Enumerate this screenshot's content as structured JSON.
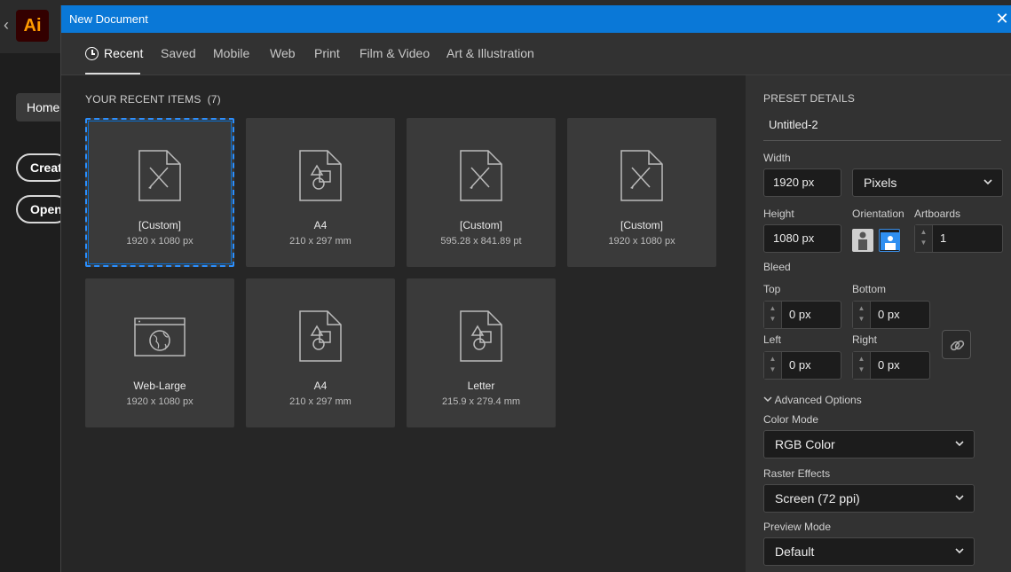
{
  "app": {
    "logo_text": "Ai",
    "home_label": "Home",
    "create_label": "Create",
    "open_label": "Open",
    "back_chevron": "‹"
  },
  "dialog": {
    "title": "New Document",
    "close_glyph": "✕"
  },
  "tabs": [
    {
      "label": "Recent",
      "active": true
    },
    {
      "label": "Saved"
    },
    {
      "label": "Mobile"
    },
    {
      "label": "Web"
    },
    {
      "label": "Print"
    },
    {
      "label": "Film & Video"
    },
    {
      "label": "Art & Illustration"
    }
  ],
  "recent": {
    "title": "YOUR RECENT ITEMS",
    "count": "(7)",
    "items": [
      {
        "name": "[Custom]",
        "dims": "1920 x 1080 px",
        "icon": "custom-doc-icon",
        "selected": true
      },
      {
        "name": "A4",
        "dims": "210 x 297 mm",
        "icon": "print-doc-icon"
      },
      {
        "name": "[Custom]",
        "dims": "595.28 x 841.89 pt",
        "icon": "custom-doc-icon"
      },
      {
        "name": "[Custom]",
        "dims": "1920 x 1080 px",
        "icon": "custom-doc-icon"
      },
      {
        "name": "Web-Large",
        "dims": "1920 x 1080 px",
        "icon": "web-doc-icon"
      },
      {
        "name": "A4",
        "dims": "210 x 297 mm",
        "icon": "print-doc-icon"
      },
      {
        "name": "Letter",
        "dims": "215.9 x 279.4 mm",
        "icon": "print-doc-icon"
      }
    ]
  },
  "preset": {
    "heading": "PRESET DETAILS",
    "name": "Untitled-2",
    "width_label": "Width",
    "width_value": "1920 px",
    "units": "Pixels",
    "height_label": "Height",
    "height_value": "1080 px",
    "orientation_label": "Orientation",
    "artboards_label": "Artboards",
    "artboards_value": "1",
    "bleed_label": "Bleed",
    "top_label": "Top",
    "top_value": "0 px",
    "bottom_label": "Bottom",
    "bottom_value": "0 px",
    "left_label": "Left",
    "left_value": "0 px",
    "right_label": "Right",
    "right_value": "0 px",
    "advanced_label": "Advanced Options",
    "color_mode_label": "Color Mode",
    "color_mode_value": "RGB Color",
    "raster_label": "Raster Effects",
    "raster_value": "Screen (72 ppi)",
    "preview_label": "Preview Mode",
    "preview_value": "Default"
  },
  "colors": {
    "accent": "#0a78d7",
    "logo_bg": "#330000",
    "logo_fg": "#ff9a00",
    "selection": "#2b8fff"
  }
}
